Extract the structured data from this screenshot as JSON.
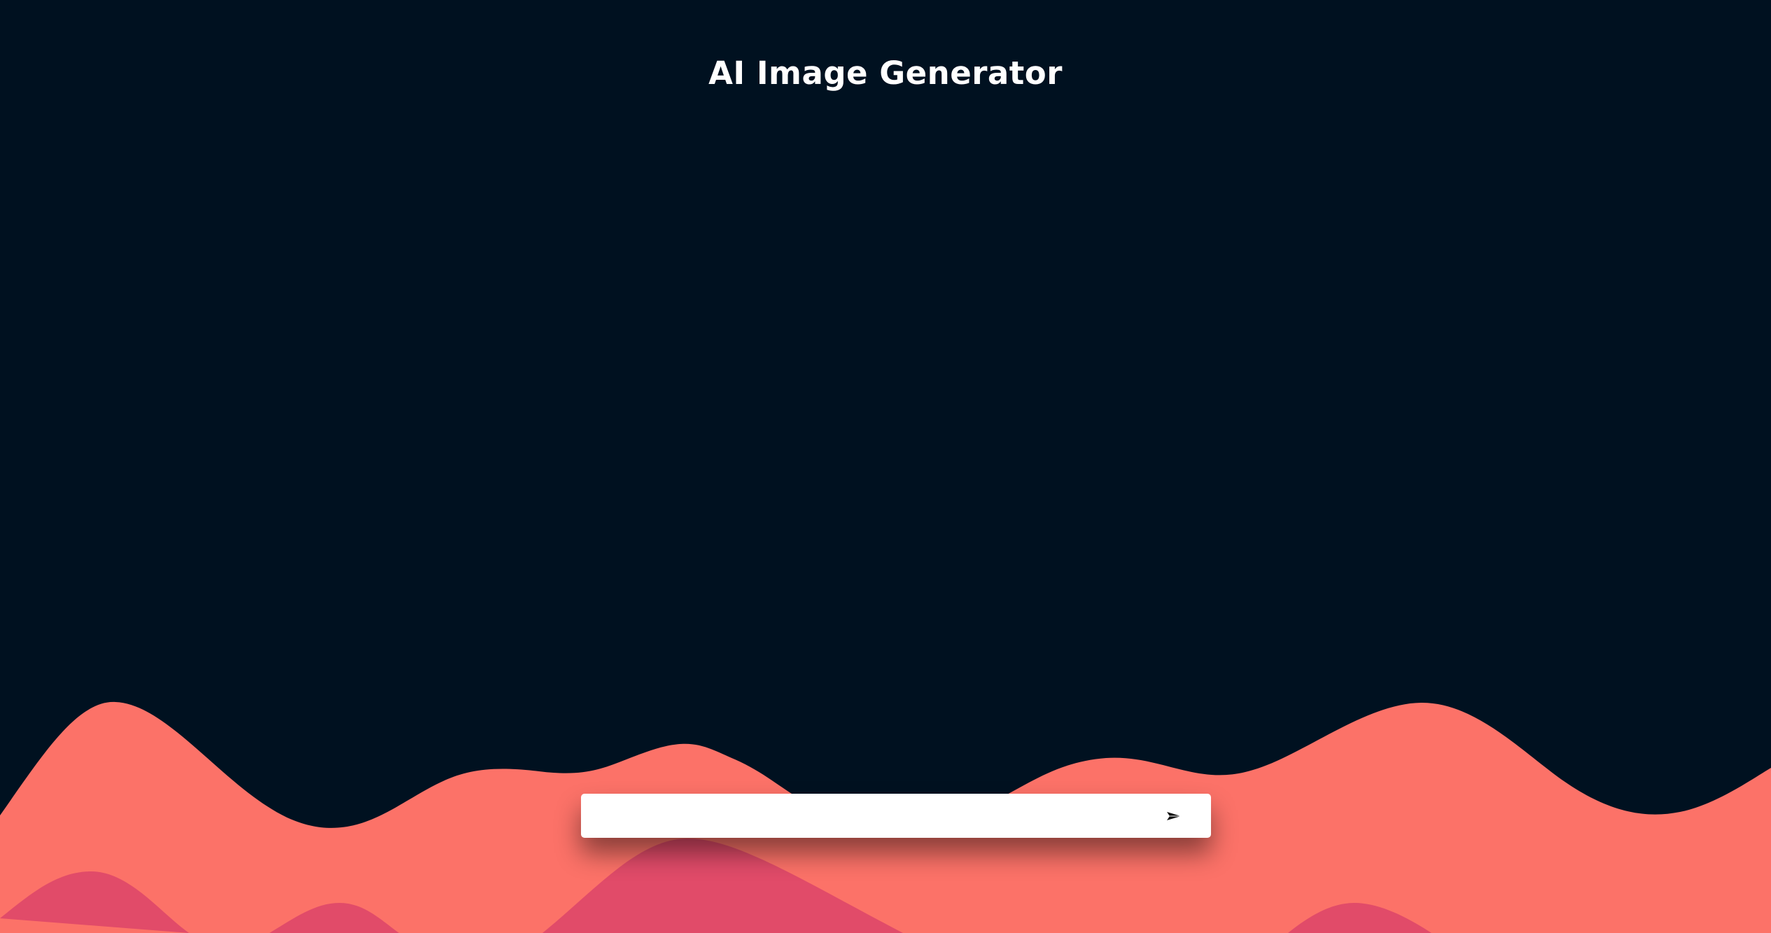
{
  "app": {
    "title": "AI Image Generator"
  },
  "prompt": {
    "value": "",
    "placeholder": ""
  },
  "icons": {
    "send": "send-arrow-icon"
  },
  "colors": {
    "background": "#001120",
    "wave_front": "#fc7268",
    "wave_back": "#e14b69",
    "wave_shadow": "#0e2a3c",
    "input_bg": "#ffffff"
  }
}
